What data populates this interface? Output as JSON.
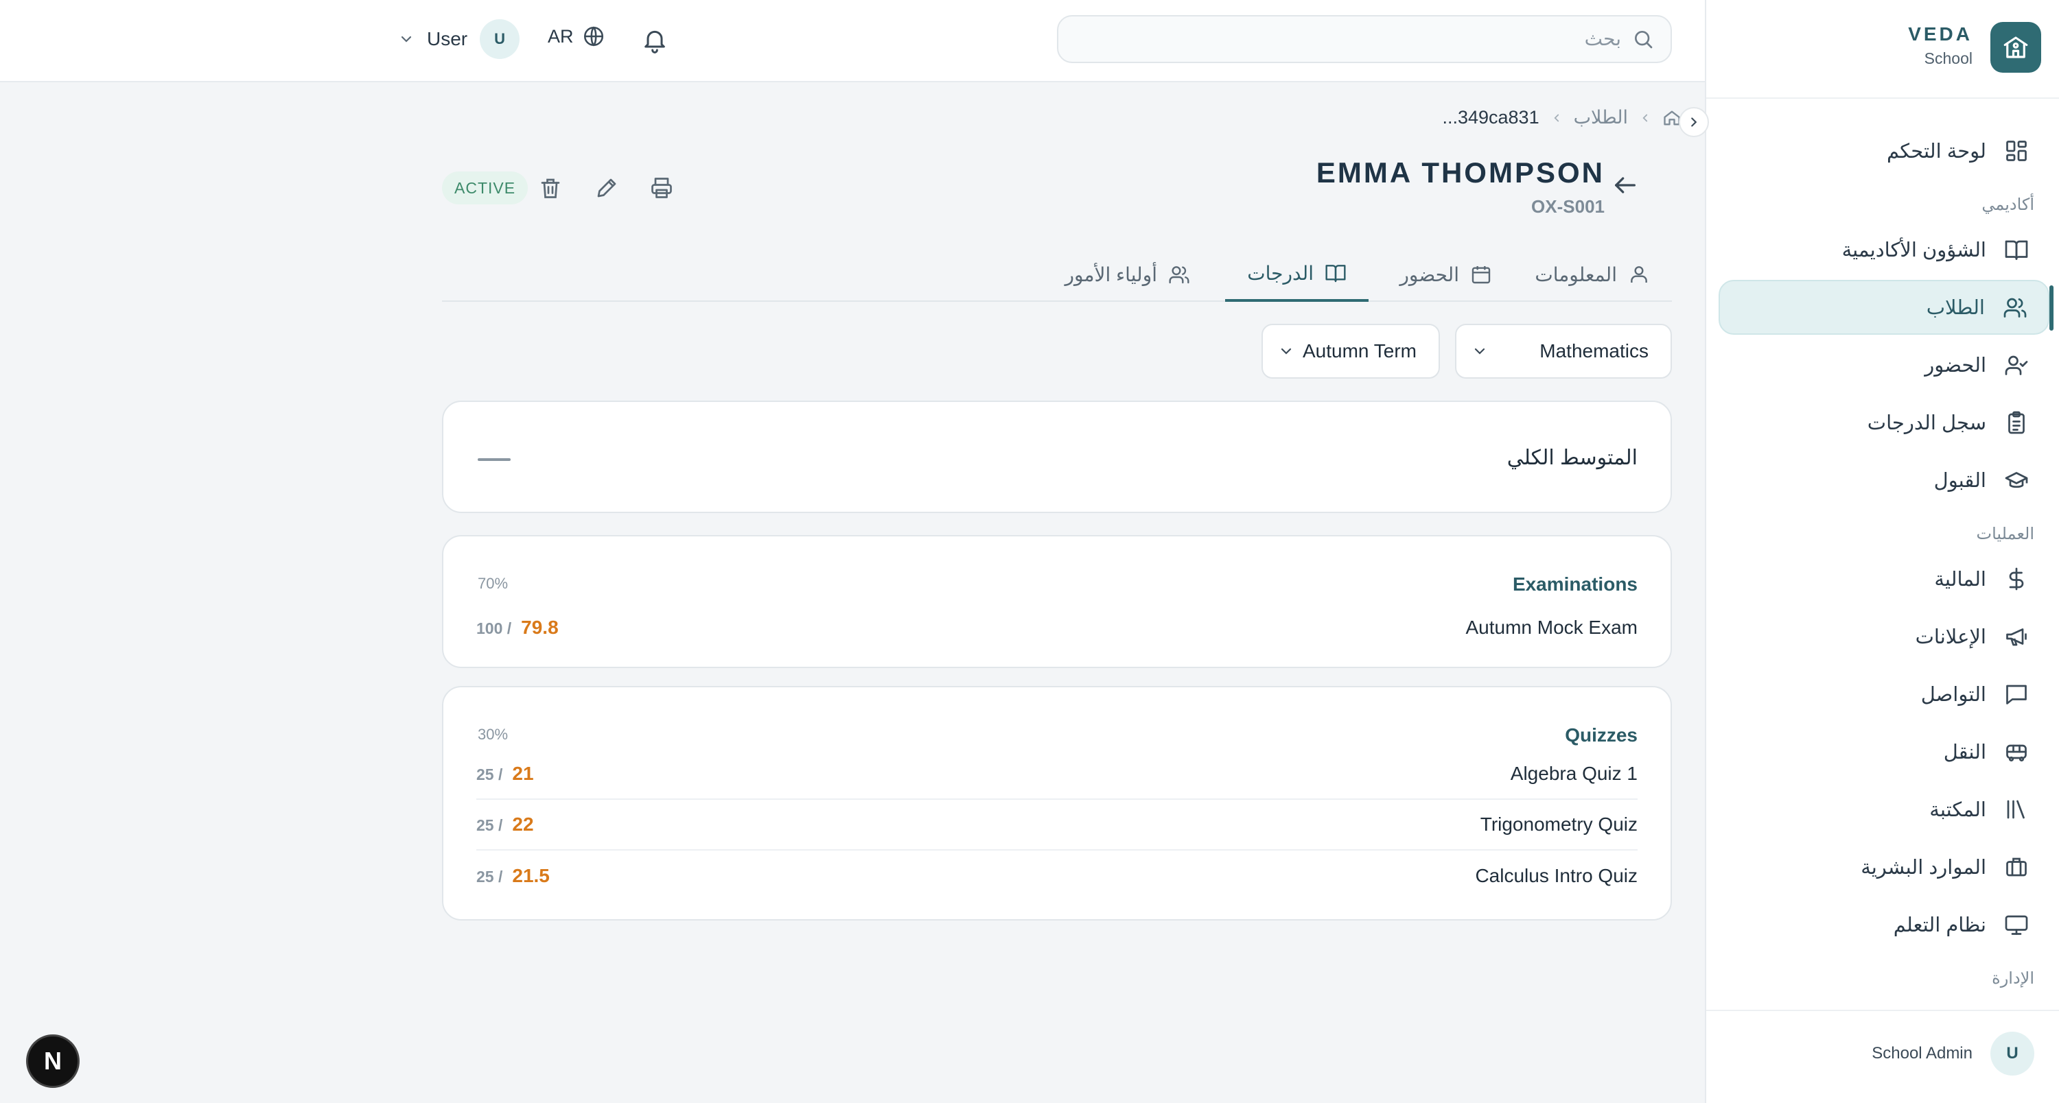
{
  "brand": {
    "name": "VEDA",
    "sub": "School"
  },
  "sidebar": {
    "items": [
      {
        "label": "لوحة التحكم",
        "icon": "dashboard-icon"
      },
      {
        "label": "الشؤون الأكاديمية",
        "icon": "book-icon"
      },
      {
        "label": "الطلاب",
        "icon": "users-icon",
        "active": true
      },
      {
        "label": "الحضور",
        "icon": "user-check-icon"
      },
      {
        "label": "سجل الدرجات",
        "icon": "clipboard-icon"
      },
      {
        "label": "القبول",
        "icon": "graduation-cap-icon"
      },
      {
        "label": "المالية",
        "icon": "dollar-icon"
      },
      {
        "label": "الإعلانات",
        "icon": "megaphone-icon"
      },
      {
        "label": "التواصل",
        "icon": "message-icon"
      },
      {
        "label": "النقل",
        "icon": "bus-icon"
      },
      {
        "label": "المكتبة",
        "icon": "library-icon"
      },
      {
        "label": "الموارد البشرية",
        "icon": "briefcase-icon"
      },
      {
        "label": "نظام التعلم",
        "icon": "monitor-icon"
      }
    ],
    "sections": {
      "academic": "أكاديمي",
      "operations": "العمليات",
      "administration": "الإدارة"
    },
    "footer": {
      "avatar": "U",
      "name": "School Admin"
    }
  },
  "topbar": {
    "search_placeholder": "بحث",
    "language": "AR",
    "user_initial": "U",
    "user_name": "User"
  },
  "breadcrumb": {
    "section": "الطلاب",
    "current": "...349ca831"
  },
  "student": {
    "name": "EMMA THOMPSON",
    "id": "OX-S001",
    "status": "ACTIVE"
  },
  "tabs": [
    {
      "label": "المعلومات",
      "icon": "user-icon"
    },
    {
      "label": "الحضور",
      "icon": "calendar-icon"
    },
    {
      "label": "الدرجات",
      "icon": "book-open-icon",
      "active": true
    },
    {
      "label": "أولياء الأمور",
      "icon": "users-icon"
    }
  ],
  "filters": {
    "subject": "Mathematics",
    "term": "Autumn Term"
  },
  "overall": {
    "label": "المتوسط الكلي",
    "value": "—"
  },
  "categories": [
    {
      "title": "Examinations",
      "weight": "70%",
      "items": [
        {
          "name": "Autumn Mock Exam",
          "score": "79.8",
          "max": "100 /"
        }
      ]
    },
    {
      "title": "Quizzes",
      "weight": "30%",
      "items": [
        {
          "name": "Algebra Quiz 1",
          "score": "21",
          "max": "25 /"
        },
        {
          "name": "Trigonometry Quiz",
          "score": "22",
          "max": "25 /"
        },
        {
          "name": "Calculus Intro Quiz",
          "score": "21.5",
          "max": "25 /"
        }
      ]
    }
  ],
  "colors": {
    "primary": "#2f6b73",
    "accent_score": "#d97a1a",
    "status_active": "#3d8a6a"
  },
  "dev_badge": "N"
}
